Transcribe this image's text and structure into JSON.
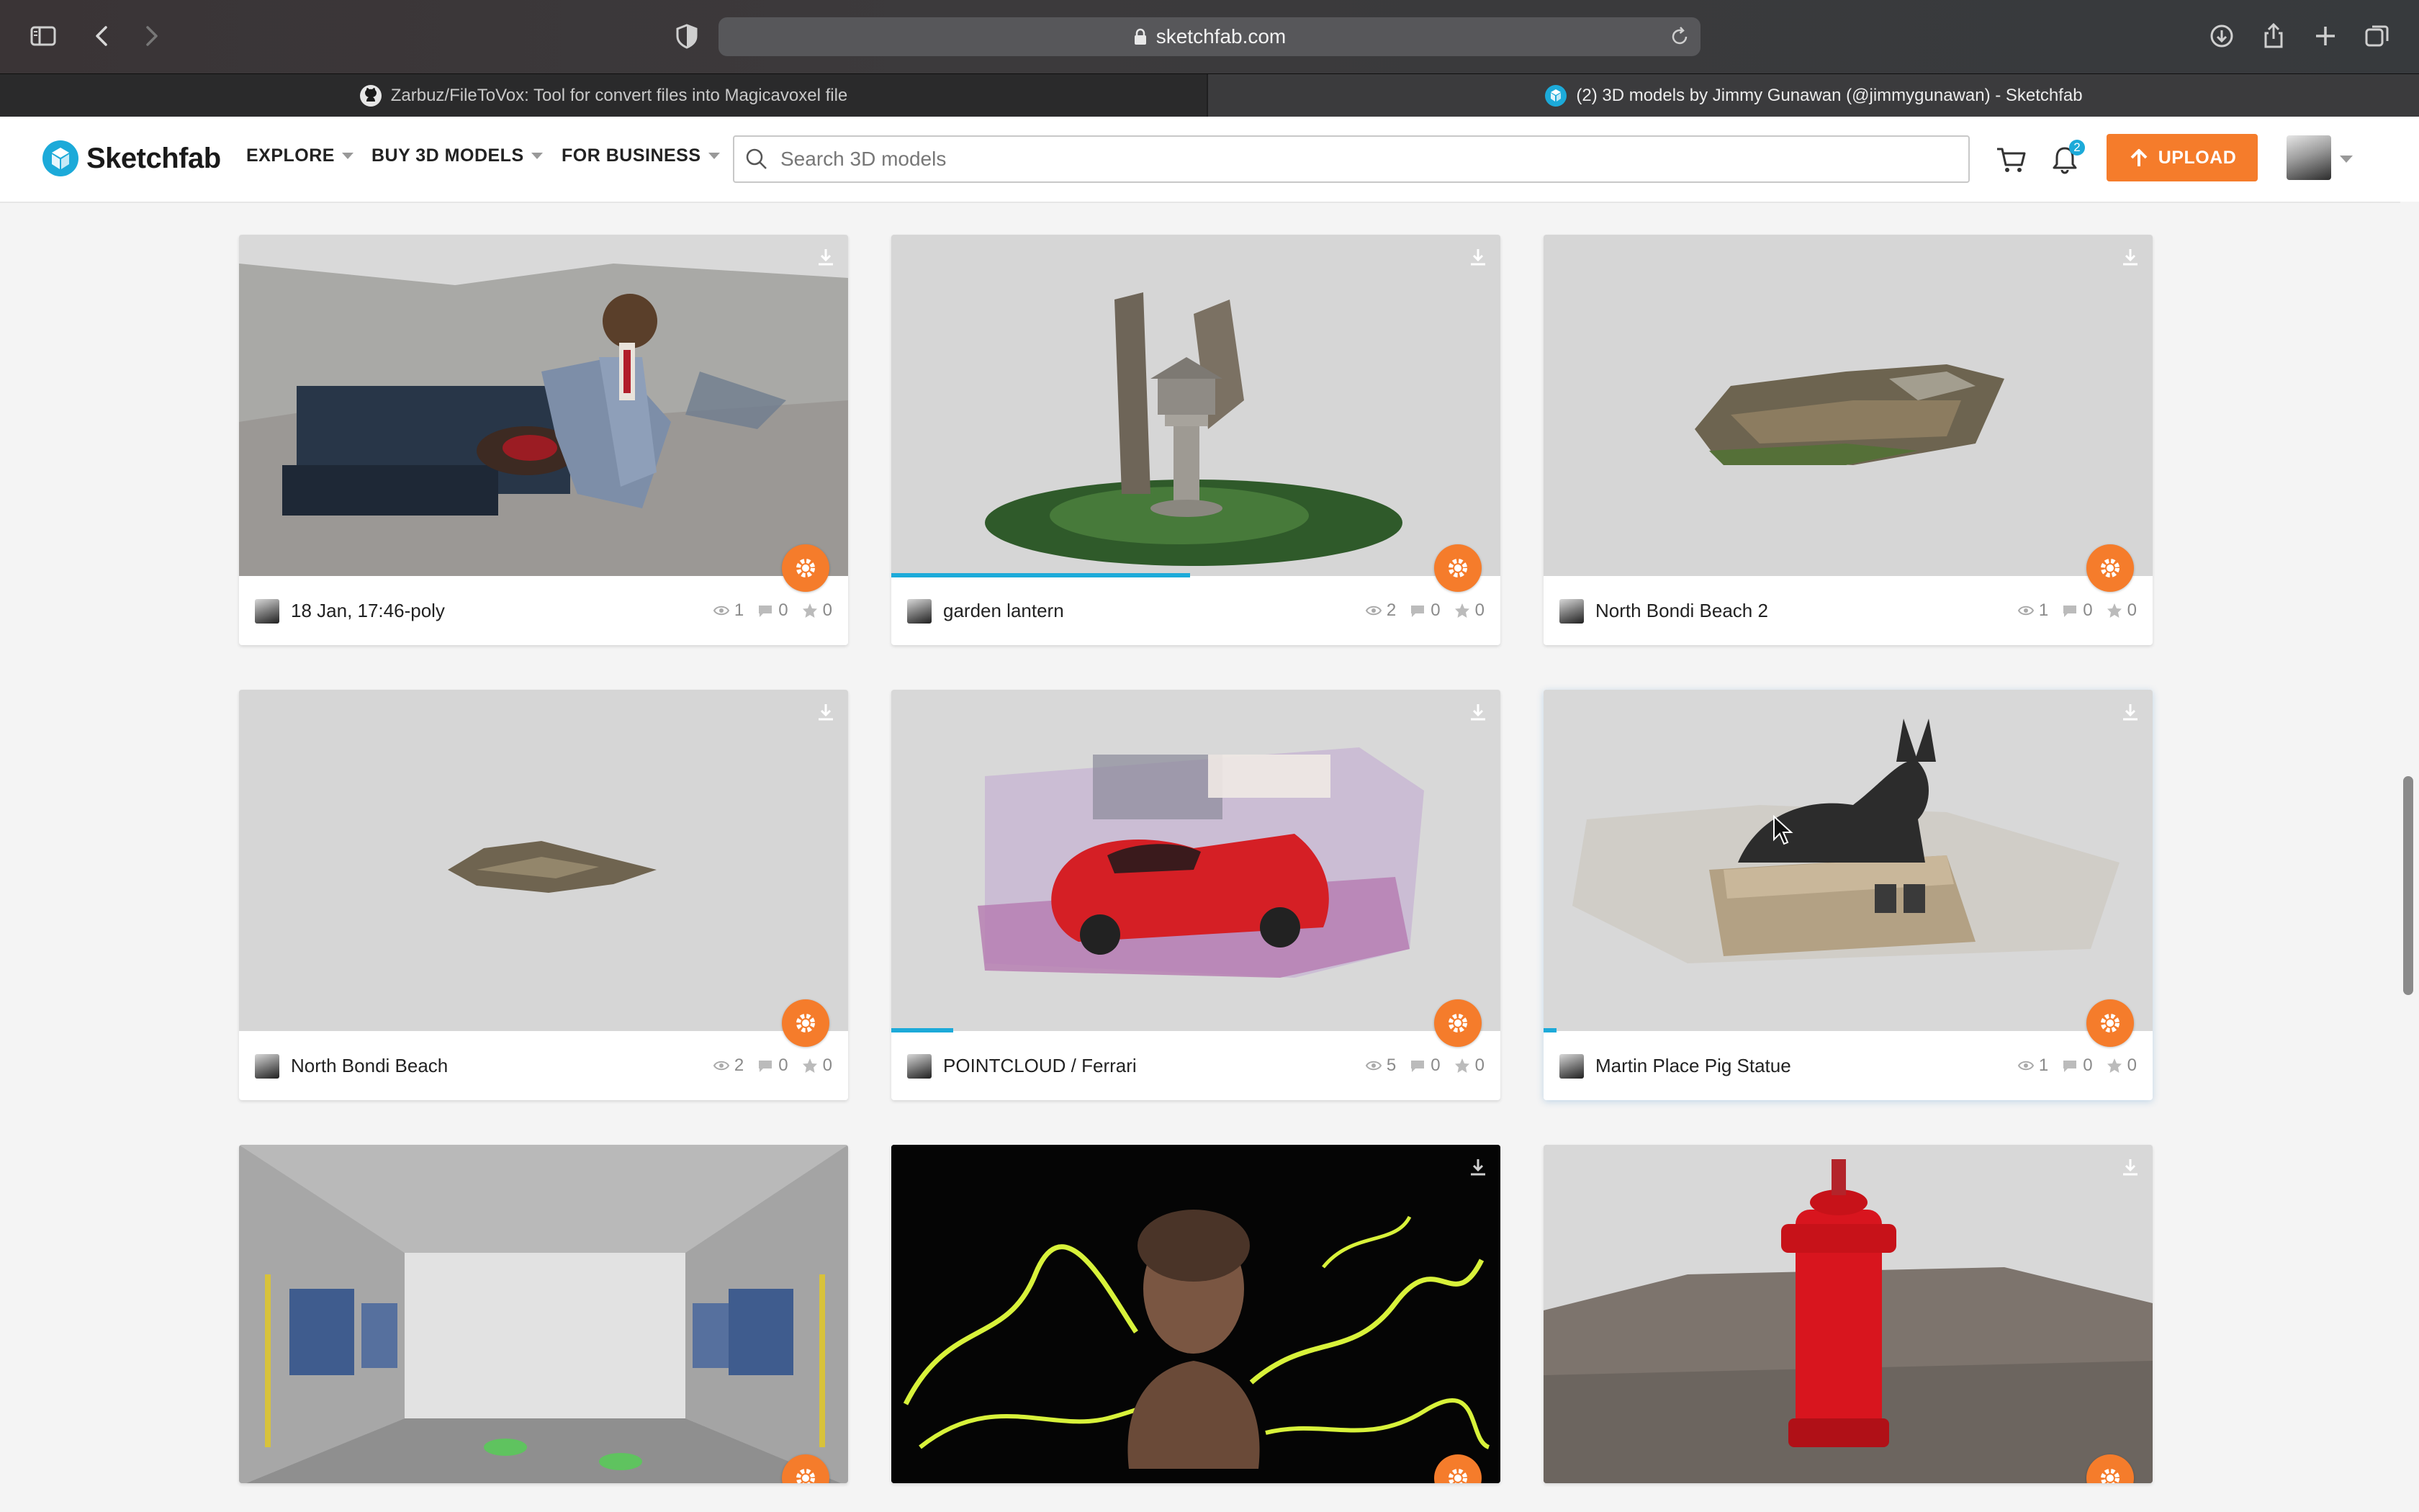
{
  "browser": {
    "url": "sketchfab.com",
    "tabs": [
      {
        "title": "Zarbuz/FileToVox: Tool for convert files into Magicavoxel file",
        "active": false
      },
      {
        "title": "(2) 3D models by Jimmy Gunawan (@jimmygunawan) - Sketchfab",
        "active": true
      }
    ]
  },
  "header": {
    "logo_text": "Sketchfab",
    "nav": [
      "EXPLORE",
      "BUY 3D MODELS",
      "FOR BUSINESS"
    ],
    "search_placeholder": "Search 3D models",
    "notification_count": "2",
    "upload_label": "UPLOAD"
  },
  "models": [
    {
      "name": "18 Jan, 17:46-poly",
      "views": "1",
      "comments": "0",
      "likes": "0"
    },
    {
      "name": "garden lantern",
      "views": "2",
      "comments": "0",
      "likes": "0",
      "progress": 0.49
    },
    {
      "name": "North Bondi Beach 2",
      "views": "1",
      "comments": "0",
      "likes": "0"
    },
    {
      "name": "North Bondi Beach",
      "views": "2",
      "comments": "0",
      "likes": "0"
    },
    {
      "name": "POINTCLOUD / Ferrari",
      "views": "5",
      "comments": "0",
      "likes": "0",
      "progress": 0.1
    },
    {
      "name": "Martin Place Pig Statue",
      "views": "1",
      "comments": "0",
      "likes": "0",
      "progress": 0.02
    },
    {
      "name": "",
      "views": "",
      "comments": "",
      "likes": ""
    },
    {
      "name": "",
      "views": "",
      "comments": "",
      "likes": ""
    },
    {
      "name": "",
      "views": "",
      "comments": "",
      "likes": ""
    }
  ],
  "colors": {
    "accent": "#f57c2b",
    "progress": "#1caad9"
  }
}
